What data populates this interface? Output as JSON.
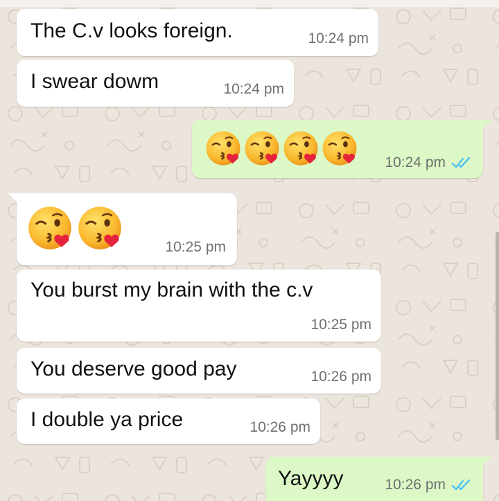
{
  "colors": {
    "background": "#ECE5DD",
    "incoming_bubble": "#FFFFFF",
    "outgoing_bubble": "#DCF8C6",
    "timestamp": "#6f6f6f",
    "read_ticks": "#4FC3F7"
  },
  "messages": [
    {
      "direction": "in",
      "text": "The C.v looks foreign.",
      "time": "10:24 pm"
    },
    {
      "direction": "in",
      "text": "I swear dowm",
      "time": "10:24 pm"
    },
    {
      "direction": "out",
      "emoji": [
        "face-throwing-kiss-icon",
        "face-throwing-kiss-icon",
        "face-throwing-kiss-icon",
        "face-throwing-kiss-icon"
      ],
      "time": "10:24 pm",
      "status": "read"
    },
    {
      "direction": "in",
      "emoji": [
        "face-throwing-kiss-icon",
        "face-throwing-kiss-icon"
      ],
      "time": "10:25 pm"
    },
    {
      "direction": "in",
      "text": "You burst my brain with the c.v",
      "time": "10:25 pm"
    },
    {
      "direction": "in",
      "text": "You deserve good pay",
      "time": "10:26 pm"
    },
    {
      "direction": "in",
      "text": "I double ya price",
      "time": "10:26 pm"
    },
    {
      "direction": "out",
      "text": "Yayyyy",
      "time": "10:26 pm",
      "status": "read"
    }
  ]
}
